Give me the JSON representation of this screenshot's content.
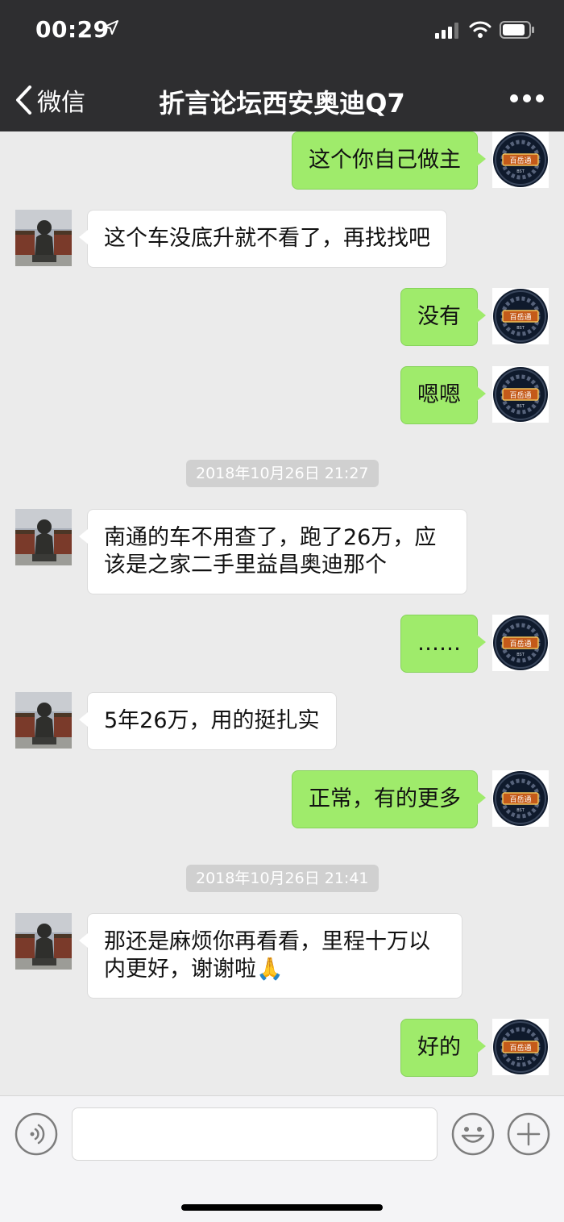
{
  "status_bar": {
    "time": "00:29"
  },
  "nav": {
    "back_label": "微信",
    "title": "折言论坛西安奥迪Q7"
  },
  "messages": [
    {
      "sender": "me",
      "text": "这个你自己做主"
    },
    {
      "sender": "them",
      "text": "这个车没底升就不看了，再找找吧"
    },
    {
      "sender": "me",
      "text": "没有"
    },
    {
      "sender": "me",
      "text": "嗯嗯"
    },
    {
      "timestamp": "2018年10月26日 21:27"
    },
    {
      "sender": "them",
      "text": "南通的车不用查了，跑了26万，应该是之家二手里益昌奥迪那个"
    },
    {
      "sender": "me",
      "text": "……"
    },
    {
      "sender": "them",
      "text": "5年26万，用的挺扎实"
    },
    {
      "sender": "me",
      "text": "正常，有的更多"
    },
    {
      "timestamp": "2018年10月26日 21:41"
    },
    {
      "sender": "them",
      "text": "那还是麻烦你再看看，里程十万以内更好，谢谢啦🙏"
    },
    {
      "sender": "me",
      "text": "好的"
    }
  ],
  "avatars": {
    "me_badge_text": "百岳通",
    "me_badge_sub": "BST"
  },
  "colors": {
    "my_bubble": "#9feb6b",
    "their_bubble": "#ffffff",
    "header": "#2e2e30",
    "chat_bg": "#ebebeb"
  },
  "icons": [
    "location-arrow-icon",
    "signal-icon",
    "wifi-icon",
    "battery-icon",
    "chevron-left-icon",
    "more-dots-icon",
    "voice-icon",
    "emoji-icon",
    "plus-icon"
  ]
}
